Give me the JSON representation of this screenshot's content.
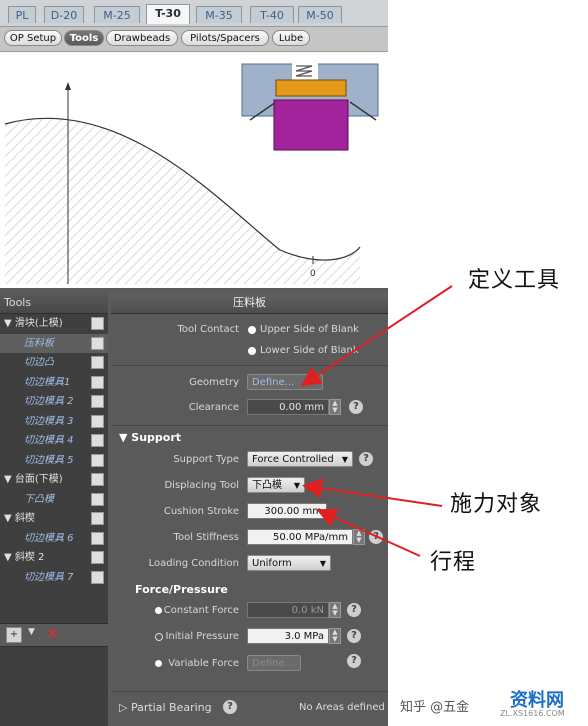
{
  "process_tabs": [
    "PL",
    "D-20",
    "M-25",
    "T-30",
    "M-35",
    "T-40",
    "M-50"
  ],
  "process_active": "T-30",
  "sub_tabs": [
    "OP Setup",
    "Tools",
    "Drawbeads",
    "Pilots/Spacers",
    "Lube"
  ],
  "sub_active": "Tools",
  "graph": {
    "zero_label": "0"
  },
  "tree": {
    "header": "Tools",
    "items": [
      {
        "label": "▼ 滑块(上模)",
        "child": false,
        "selected": false
      },
      {
        "label": "压料板",
        "child": true,
        "selected": true
      },
      {
        "label": "切边凸",
        "child": true,
        "selected": false
      },
      {
        "label": "切边模具1",
        "child": true,
        "selected": false
      },
      {
        "label": "切边模具 2",
        "child": true,
        "selected": false
      },
      {
        "label": "切边模具 3",
        "child": true,
        "selected": false
      },
      {
        "label": "切边模具 4",
        "child": true,
        "selected": false
      },
      {
        "label": "切边模具 5",
        "child": true,
        "selected": false
      },
      {
        "label": "▼ 台面(下模)",
        "child": false,
        "selected": false
      },
      {
        "label": "下凸模",
        "child": true,
        "selected": false
      },
      {
        "label": "▼ 斜楔",
        "child": false,
        "selected": false
      },
      {
        "label": "切边模具 6",
        "child": true,
        "selected": false
      },
      {
        "label": "▼ 斜楔 2",
        "child": false,
        "selected": false
      },
      {
        "label": "切边模具 7",
        "child": true,
        "selected": false
      }
    ]
  },
  "props": {
    "title": "压料板",
    "tool_contact_label": "Tool Contact",
    "upper_side": "Upper Side of Blank",
    "lower_side": "Lower Side of Blank",
    "geometry_label": "Geometry",
    "geometry_btn": "Define...",
    "clearance_label": "Clearance",
    "clearance_value": "0.00 mm",
    "support_section": "▼ Support",
    "support_type_label": "Support Type",
    "support_type_value": "Force Controlled",
    "displacing_tool_label": "Displacing Tool",
    "displacing_tool_value": "下凸模",
    "cushion_stroke_label": "Cushion Stroke",
    "cushion_stroke_value": "300.00 mm",
    "tool_stiffness_label": "Tool Stiffness",
    "tool_stiffness_value": "50.00 MPa/mm",
    "loading_condition_label": "Loading Condition",
    "loading_condition_value": "Uniform",
    "force_section": "Force/Pressure",
    "constant_force_label": "Constant Force",
    "constant_force_value": "0.0 kN",
    "initial_pressure_label": "Initial Pressure",
    "initial_pressure_value": "3.0 MPa",
    "variable_force_label": "Variable Force",
    "variable_force_btn": "Define...",
    "partial_bearing_label": "▷ Partial Bearing",
    "partial_bearing_value": "No Areas defined"
  },
  "annotations": {
    "define_tool": "定义工具",
    "force_target": "施力对象",
    "stroke": "行程",
    "arrow_color": "#e02020"
  },
  "watermark": {
    "zhihu": "知乎 @五金",
    "site": "资料网",
    "site_url": "ZL.XS1616.COM"
  }
}
